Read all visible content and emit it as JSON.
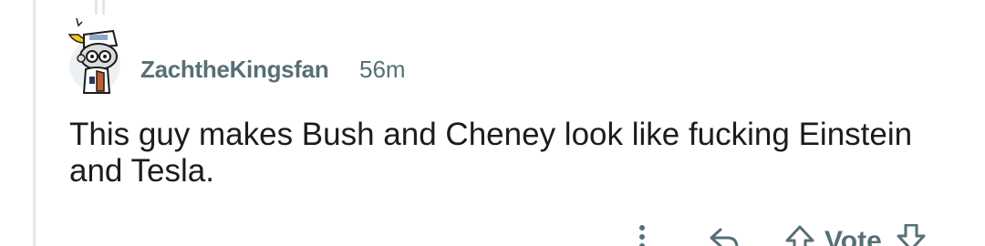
{
  "comment": {
    "author": "ZachtheKingsfan",
    "age": "56m",
    "text": "This guy makes Bush and Cheney look like fucking Einstein and Tesla.",
    "avatar_icon": "snoo-avatar-icon"
  },
  "actions": {
    "more_icon": "more-vertical-icon",
    "reply_icon": "reply-arrow-icon",
    "upvote_icon": "upvote-arrow-icon",
    "vote_label": "Vote",
    "downvote_icon": "downvote-arrow-icon"
  },
  "colors": {
    "meta": "#576f76",
    "text": "#1c1c1c",
    "thread_line": "#e4e6e8"
  }
}
